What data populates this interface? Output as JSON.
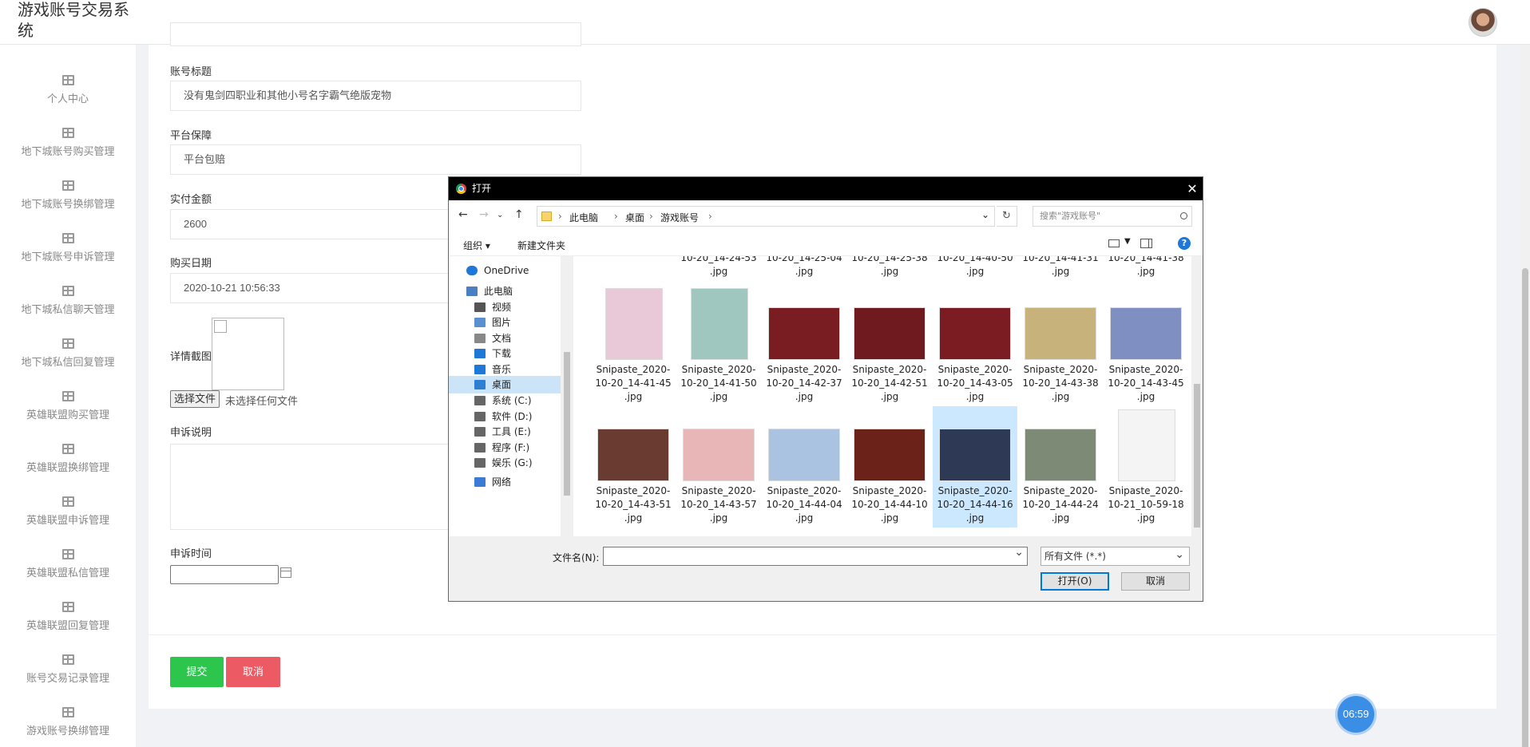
{
  "header": {
    "title": "游戏账号交易系统"
  },
  "sidebar": {
    "items": [
      {
        "label": "个人中心"
      },
      {
        "label": "地下城账号购买管理"
      },
      {
        "label": "地下城账号换绑管理"
      },
      {
        "label": "地下城账号申诉管理"
      },
      {
        "label": "地下城私信聊天管理"
      },
      {
        "label": "地下城私信回复管理"
      },
      {
        "label": "英雄联盟购买管理"
      },
      {
        "label": "英雄联盟换绑管理"
      },
      {
        "label": "英雄联盟申诉管理"
      },
      {
        "label": "英雄联盟私信管理"
      },
      {
        "label": "英雄联盟回复管理"
      },
      {
        "label": "账号交易记录管理"
      },
      {
        "label": "游戏账号换绑管理"
      }
    ]
  },
  "form": {
    "title_label": "账号标题",
    "title_value": "没有鬼剑四职业和其他小号名字霸气绝版宠物",
    "guarantee_label": "平台保障",
    "guarantee_value": "平台包赔",
    "amount_label": "实付金额",
    "amount_value": "2600",
    "date_label": "购买日期",
    "date_value": "2020-10-21 10:56:33",
    "screenshot_label": "详情截图",
    "file_button": "选择文件",
    "file_none": "未选择任何文件",
    "appeal_label": "申诉说明",
    "appeal_time_label": "申诉时间",
    "submit": "提交",
    "cancel": "取消"
  },
  "timer": "06:59",
  "dialog": {
    "title": "打开",
    "close": "✕",
    "breadcrumb": [
      "此电脑",
      "桌面",
      "游戏账号"
    ],
    "search_placeholder": "搜索\"游戏账号\"",
    "organize": "组织 ▾",
    "new_folder": "新建文件夹",
    "help": "?",
    "tree": [
      {
        "label": "OneDrive",
        "icon": "cloud-icon"
      },
      {
        "label": "此电脑",
        "icon": "computer-icon"
      },
      {
        "label": "视频",
        "icon": "video-icon"
      },
      {
        "label": "图片",
        "icon": "picture-icon"
      },
      {
        "label": "文档",
        "icon": "document-icon"
      },
      {
        "label": "下载",
        "icon": "download-icon"
      },
      {
        "label": "音乐",
        "icon": "music-icon"
      },
      {
        "label": "桌面",
        "icon": "desktop-icon",
        "selected": true
      },
      {
        "label": "系统 (C:)",
        "icon": "drive-icon"
      },
      {
        "label": "软件 (D:)",
        "icon": "drive-icon"
      },
      {
        "label": "工具 (E:)",
        "icon": "drive-icon"
      },
      {
        "label": "程序 (F:)",
        "icon": "drive-icon"
      },
      {
        "label": "娱乐 (G:)",
        "icon": "drive-icon"
      },
      {
        "label": "网络",
        "icon": "network-icon"
      }
    ],
    "top_row": [
      {
        "l2": "10-20_14-24-53",
        "l3": ".jpg"
      },
      {
        "l2": "10-20_14-25-04",
        "l3": ".jpg"
      },
      {
        "l2": "10-20_14-25-38",
        "l3": ".jpg"
      },
      {
        "l2": "10-20_14-40-50",
        "l3": ".jpg"
      },
      {
        "l2": "10-20_14-41-31",
        "l3": ".jpg"
      },
      {
        "l2": "10-20_14-41-38",
        "l3": ".jpg"
      }
    ],
    "files_row1": [
      {
        "l1": "Snipaste_2020-",
        "l2": "10-20_14-41-45",
        "l3": ".jpg",
        "color": "#e9c9d8"
      },
      {
        "l1": "Snipaste_2020-",
        "l2": "10-20_14-41-50",
        "l3": ".jpg",
        "color": "#9fc7c0"
      },
      {
        "l1": "Snipaste_2020-",
        "l2": "10-20_14-42-37",
        "l3": ".jpg",
        "color": "#7a1d22"
      },
      {
        "l1": "Snipaste_2020-",
        "l2": "10-20_14-42-51",
        "l3": ".jpg",
        "color": "#6e1a1f"
      },
      {
        "l1": "Snipaste_2020-",
        "l2": "10-20_14-43-05",
        "l3": ".jpg",
        "color": "#7b1c22"
      },
      {
        "l1": "Snipaste_2020-",
        "l2": "10-20_14-43-38",
        "l3": ".jpg",
        "color": "#c8b27c"
      },
      {
        "l1": "Snipaste_2020-",
        "l2": "10-20_14-43-45",
        "l3": ".jpg",
        "color": "#7f8fc2"
      }
    ],
    "files_row2": [
      {
        "l1": "Snipaste_2020-",
        "l2": "10-20_14-43-51",
        "l3": ".jpg",
        "color": "#6a3b30"
      },
      {
        "l1": "Snipaste_2020-",
        "l2": "10-20_14-43-57",
        "l3": ".jpg",
        "color": "#e8b6b6"
      },
      {
        "l1": "Snipaste_2020-",
        "l2": "10-20_14-44-04",
        "l3": ".jpg",
        "color": "#aac3e0"
      },
      {
        "l1": "Snipaste_2020-",
        "l2": "10-20_14-44-10",
        "l3": ".jpg",
        "color": "#6b2218"
      },
      {
        "l1": "Snipaste_2020-",
        "l2": "10-20_14-44-16",
        "l3": ".jpg",
        "color": "#2e3a55",
        "selected": true
      },
      {
        "l1": "Snipaste_2020-",
        "l2": "10-20_14-44-24",
        "l3": ".jpg",
        "color": "#7d8a76"
      },
      {
        "l1": "Snipaste_2020-",
        "l2": "10-21_10-59-18",
        "l3": ".jpg",
        "color": "#f4f4f4"
      }
    ],
    "filename_label": "文件名(N):",
    "filename_value": "",
    "filter_value": "所有文件 (*.*)",
    "open_button": "打开(O)",
    "cancel_button": "取消"
  }
}
